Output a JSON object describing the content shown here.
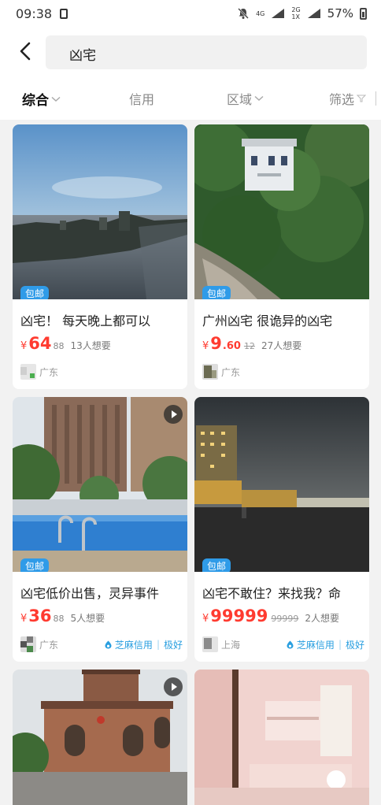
{
  "status_bar": {
    "time": "09:38",
    "network_top": "4G",
    "network_bottom": "2G",
    "network_sub": "1X",
    "battery": "57%"
  },
  "search": {
    "query": "凶宅"
  },
  "filters": {
    "comprehensive": "综合",
    "credit": "信用",
    "area": "区域",
    "filter": "筛选"
  },
  "listings": [
    {
      "badge": "包邮",
      "title": "凶宅！ 每天晚上都可以",
      "currency": "¥",
      "price_int": "64",
      "price_dec": "88",
      "want": "13人想要",
      "location": "广东"
    },
    {
      "badge": "包邮",
      "title": "广州凶宅 很诡异的凶宅",
      "currency": "¥",
      "price_int": "9",
      "price_dec": ".60",
      "orig_price": "12",
      "want": "27人想要",
      "location": "广东"
    },
    {
      "badge": "包邮",
      "title": "凶宅低价出售，灵异事件",
      "currency": "¥",
      "price_int": "36",
      "price_dec": "88",
      "want": "5人想要",
      "location": "广东",
      "credit_label": "芝麻信用",
      "credit_rating": "极好"
    },
    {
      "badge": "包邮",
      "title": "凶宅不敢住？来找我？命",
      "currency": "¥",
      "price_int": "99999",
      "orig_price": "99999",
      "want": "2人想要",
      "location": "上海",
      "credit_label": "芝麻信用",
      "credit_rating": "极好"
    }
  ],
  "colors": {
    "price": "#ff3b30",
    "badge": "#2f9be8",
    "credit": "#2a9fe0"
  }
}
